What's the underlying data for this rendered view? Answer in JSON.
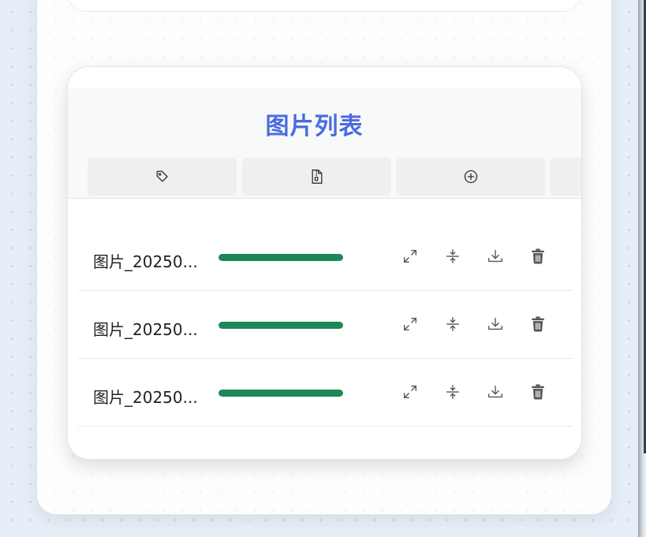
{
  "panel": {
    "title": "图片列表"
  },
  "toolbar": {
    "buttons": [
      {
        "icon": "tag-icon"
      },
      {
        "icon": "zip-file-icon"
      },
      {
        "icon": "add-circle-icon"
      },
      {
        "icon": "more-tool-icon"
      }
    ]
  },
  "images": [
    {
      "name": "图片_20250...",
      "progress": 1.0,
      "actions": [
        "expand-icon",
        "compress-icon",
        "download-icon",
        "delete-icon"
      ]
    },
    {
      "name": "图片_20250...",
      "progress": 1.0,
      "actions": [
        "expand-icon",
        "compress-icon",
        "download-icon",
        "delete-icon"
      ]
    },
    {
      "name": "图片_20250...",
      "progress": 1.0,
      "actions": [
        "expand-icon",
        "compress-icon",
        "download-icon",
        "delete-icon"
      ]
    }
  ],
  "colors": {
    "title": "#4a6be2",
    "progress": "#1d8755",
    "icon": "#555555"
  }
}
